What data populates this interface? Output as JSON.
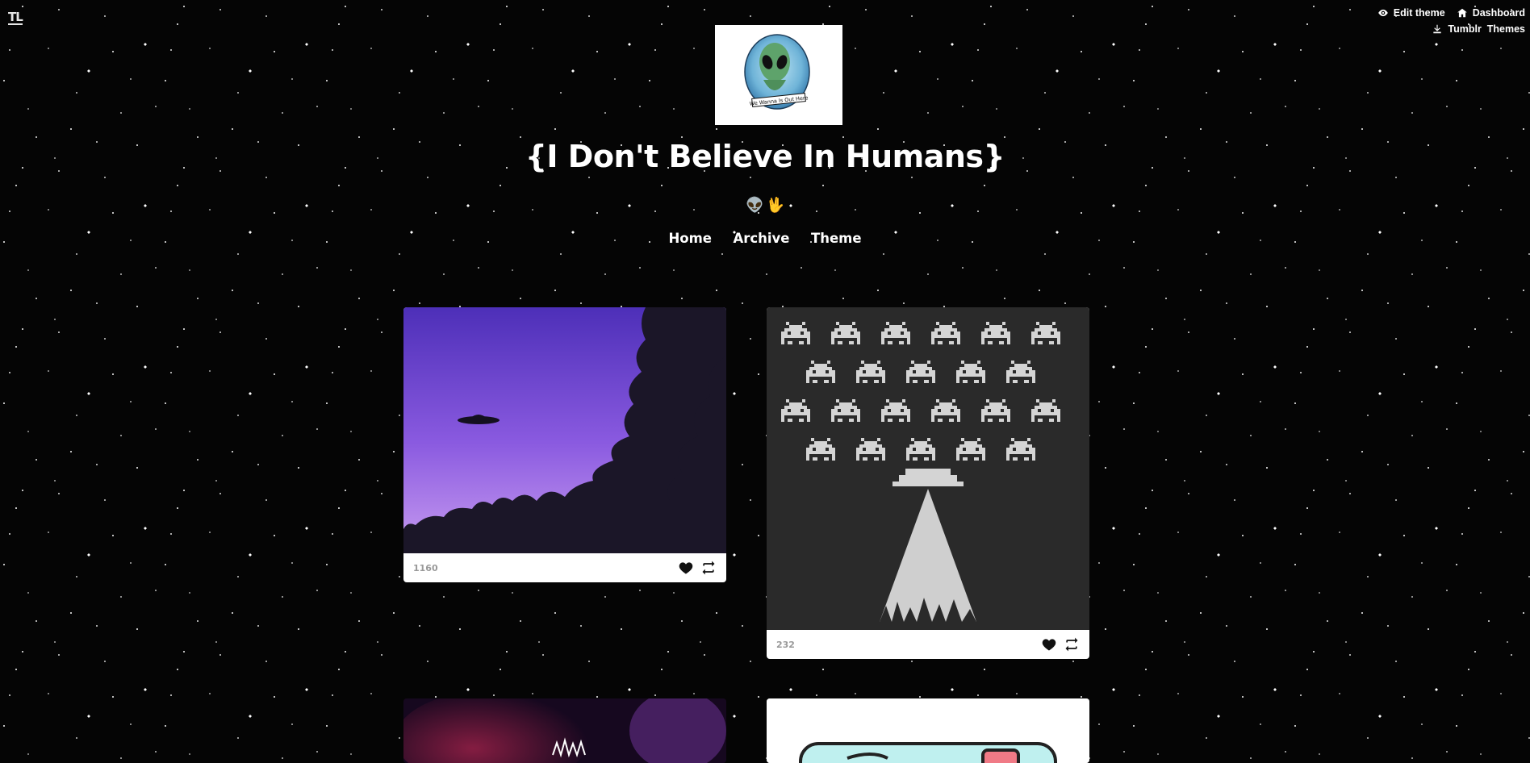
{
  "corner_logo": "TL",
  "topbar": {
    "edit_theme": "Edit theme",
    "dashboard": "Dashboard",
    "tumblr_themes": "Tumblr  Themes"
  },
  "avatar_caption": "We Wanna Is Out Here",
  "blog": {
    "title": "{I Don't Believe In Humans}",
    "description_emojis": [
      "👽",
      "🖖"
    ]
  },
  "nav": {
    "home": "Home",
    "archive": "Archive",
    "theme": "Theme"
  },
  "posts": [
    {
      "notes": "1160",
      "image": "ufo-purple-sky-silhouette-trees"
    },
    {
      "notes": "232",
      "image": "pixel-space-invaders-ufo-beam"
    },
    {
      "notes": "",
      "image": "dark-purple-abstract"
    },
    {
      "notes": "",
      "image": "cartoon-cassette-tape"
    }
  ],
  "icons": {
    "eye": "eye-icon",
    "home": "home-icon",
    "download": "download-icon",
    "heart": "heart-icon",
    "reblog": "reblog-icon"
  },
  "colors": {
    "background": "#050505",
    "accent_white": "#ffffff",
    "notes_gray": "#999999"
  }
}
